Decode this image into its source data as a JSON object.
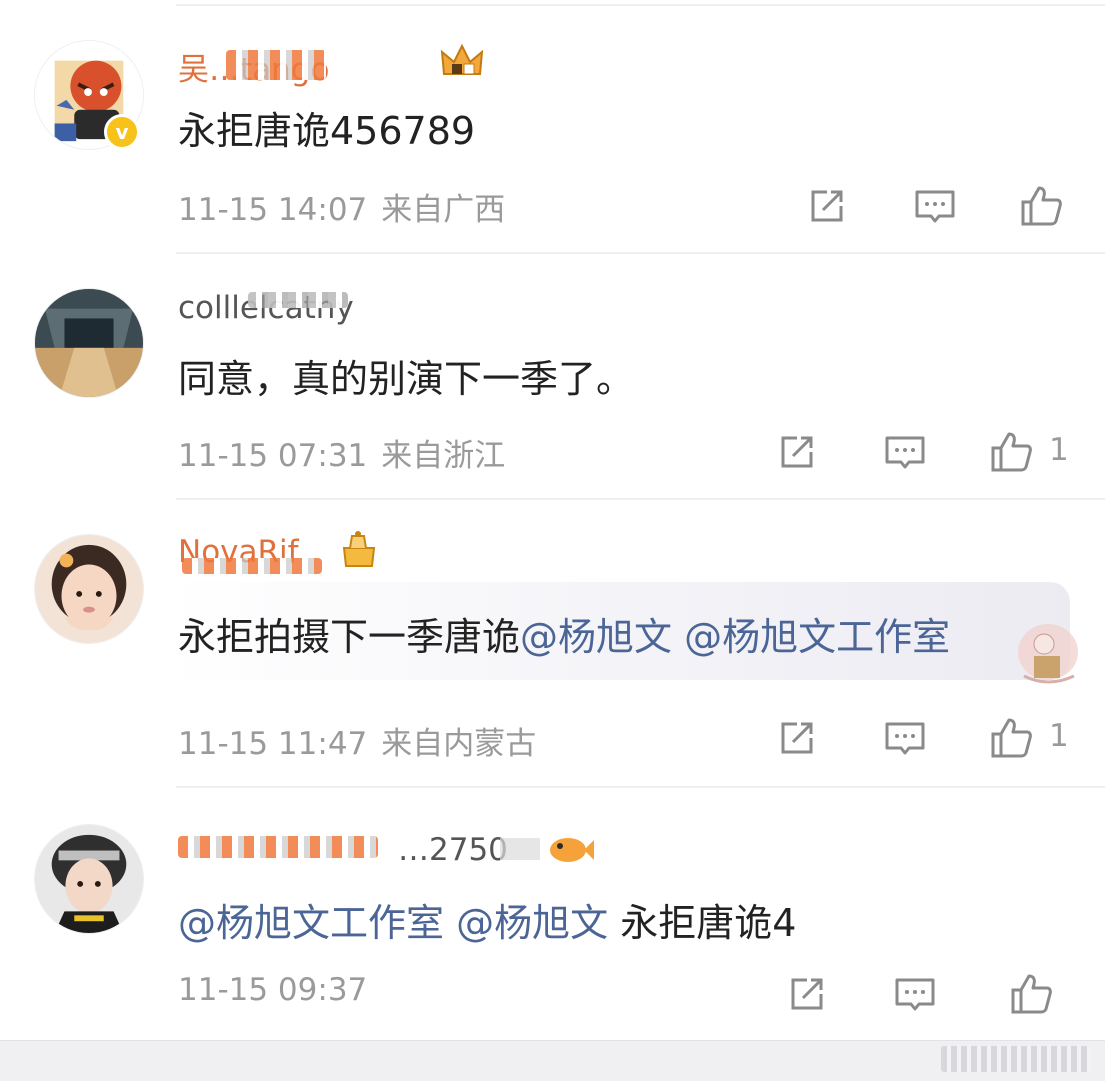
{
  "comments": [
    {
      "username": "吴…tango",
      "text": "永拒唐诡456789",
      "time": "11-15 14:07",
      "location": "来自广西",
      "likes": ""
    },
    {
      "username": "colllelcatny",
      "text": "同意，真的别演下一季了。",
      "time": "11-15 07:31",
      "location": "来自浙江",
      "likes": "1"
    },
    {
      "username": "NovaRif",
      "text_plain": "永拒拍摄下一季唐诡",
      "mention1": "@杨旭文",
      "mention2": "@杨旭文工作室",
      "time": "11-15 11:47",
      "location": "来自内蒙古",
      "likes": "1"
    },
    {
      "username": "…2750",
      "mention1": "@杨旭文工作室",
      "mention2": "@杨旭文",
      "text_plain": "永拒唐诡4",
      "time": "11-15 09:37",
      "location": "",
      "likes": ""
    }
  ],
  "icons": {
    "share": "share-icon",
    "comment": "comment-icon",
    "like": "thumbs-up-icon",
    "verified": "verified-badge-icon"
  },
  "colors": {
    "mention": "#4a6596",
    "meta": "#9a9a9a",
    "verified": "#f7c21a"
  }
}
